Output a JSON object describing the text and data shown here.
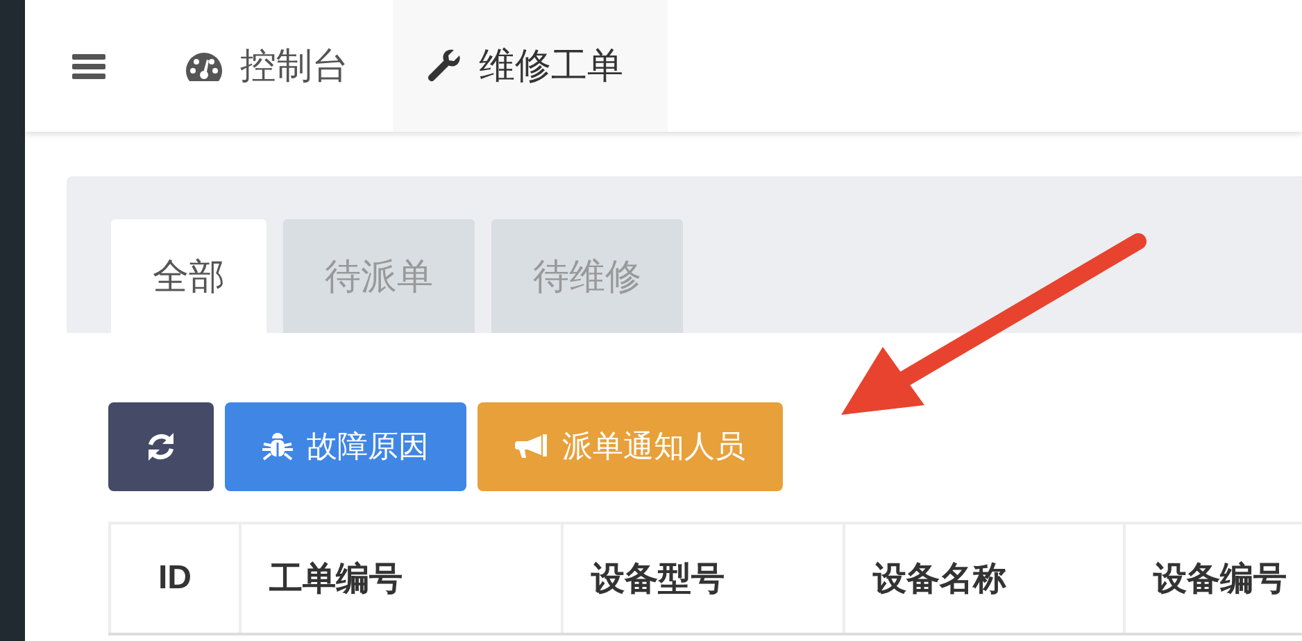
{
  "nav": {
    "tabs": [
      {
        "label": "控制台",
        "selected": false
      },
      {
        "label": "维修工单",
        "selected": true
      }
    ]
  },
  "sub_tabs": [
    {
      "label": "全部",
      "selected": true
    },
    {
      "label": "待派单",
      "selected": false
    },
    {
      "label": "待维修",
      "selected": false
    }
  ],
  "toolbar": [
    {
      "kind": "refresh"
    },
    {
      "kind": "bug",
      "label": "故障原因"
    },
    {
      "kind": "announce",
      "label": "派单通知人员"
    }
  ],
  "table": {
    "columns": [
      "ID",
      "工单编号",
      "设备型号",
      "设备名称",
      "设备编号"
    ]
  }
}
